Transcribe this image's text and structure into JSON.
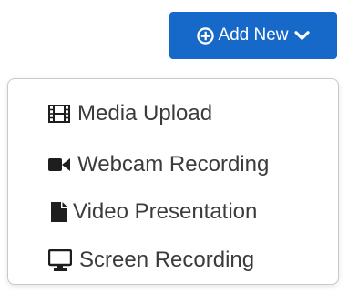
{
  "add_button": {
    "label": "Add New",
    "icon_left": "plus-circle-icon",
    "icon_right": "chevron-down-icon",
    "color": "#1669c8"
  },
  "menu": {
    "items": [
      {
        "label": "Media Upload",
        "icon": "film-icon"
      },
      {
        "label": "Webcam Recording",
        "icon": "video-camera-icon"
      },
      {
        "label": "Video Presentation",
        "icon": "file-icon"
      },
      {
        "label": "Screen Recording",
        "icon": "monitor-icon"
      }
    ]
  }
}
